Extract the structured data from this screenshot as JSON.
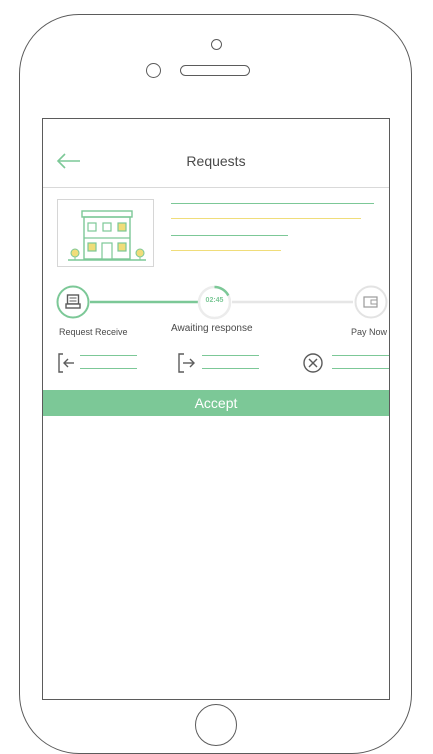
{
  "screen": {
    "title": "Requests"
  },
  "progress": {
    "steps": [
      {
        "label": "Request Receive",
        "state": "done"
      },
      {
        "label": "Awaiting response",
        "state": "current",
        "timer": "02:45"
      },
      {
        "label": "Pay Now",
        "state": "pending"
      }
    ],
    "timer_progress_fraction": 0.2
  },
  "actions": {
    "accept_label": "Accept"
  },
  "colors": {
    "accent_green": "#7cc897",
    "accent_yellow": "#f0dd7a",
    "outline": "#5b5b5b",
    "muted_gray": "#d9d9d9"
  },
  "icons": {
    "back": "arrow-left-icon",
    "check_in": "sign-in-icon",
    "check_out": "sign-out-icon",
    "cancel": "cancel-circle-icon",
    "step1": "laptop-icon",
    "step3": "wallet-icon"
  }
}
